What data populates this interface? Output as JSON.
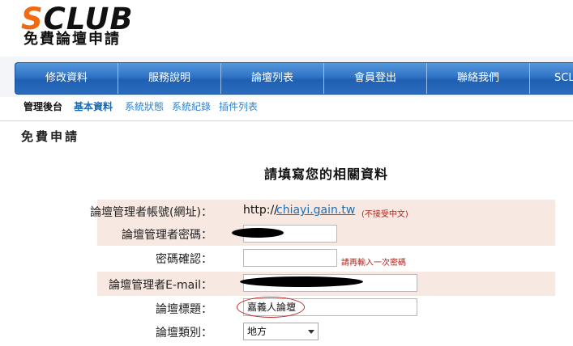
{
  "logo": {
    "main_s": "S",
    "main_rest": "CLUB",
    "subtitle": "免費論壇申請"
  },
  "nav": {
    "items": [
      "修改資料",
      "服務說明",
      "論壇列表",
      "會員登出",
      "聯絡我們",
      "SCL"
    ]
  },
  "subnav": {
    "manage": "管理後台",
    "basic": "基本資料",
    "status": "系統狀態",
    "log": "系統紀錄",
    "plugin": "插件列表"
  },
  "section_title": "免費申請",
  "form": {
    "title": "請填寫您的相關資料",
    "account_label": "論壇管理者帳號(網址)：",
    "url_prefix": "http://",
    "url_value": "chiayi.gain.tw",
    "account_note": "(不接受中文)",
    "password_label": "論壇管理者密碼：",
    "confirm_label": "密碼確認：",
    "confirm_note": "請再輸入一次密碼",
    "email_label": "論壇管理者E-mail：",
    "forum_title_label": "論壇標題：",
    "forum_title_value": "嘉義人論壇",
    "forum_type_label": "論壇類別：",
    "forum_type_value": "地方"
  },
  "colors": {
    "nav_blue": "#2f73c5",
    "logo_orange": "#ef6a12",
    "row_shade": "#f8e8e2",
    "note_red": "#b0241c",
    "link_blue": "#1a6fb5"
  }
}
